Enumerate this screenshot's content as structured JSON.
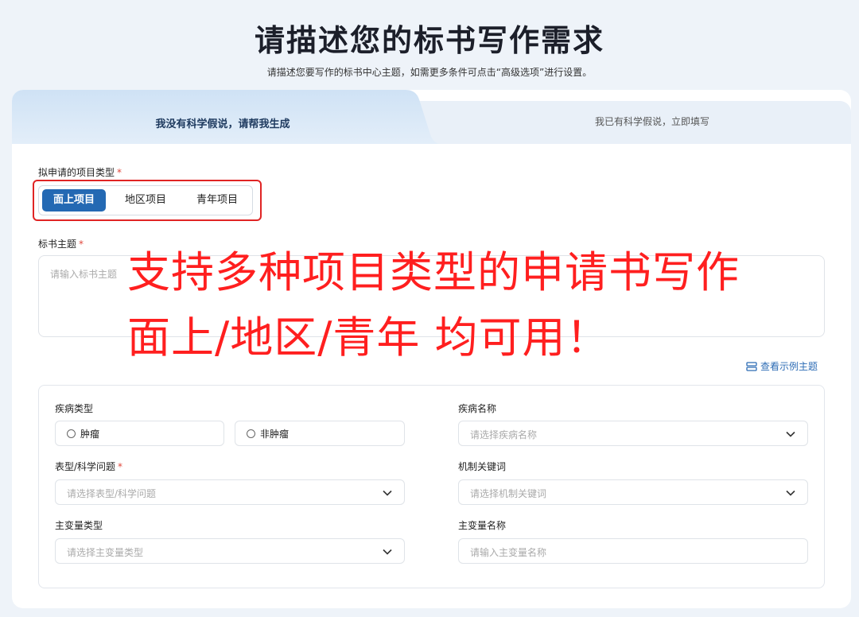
{
  "header": {
    "title": "请描述您的标书写作需求",
    "subtitle": "请描述您要写作的标书中心主题，如需更多条件可点击“高级选项”进行设置。"
  },
  "tabs": {
    "active": "我没有科学假说，请帮我生成",
    "inactive": "我已有科学假说，立即填写"
  },
  "project_type": {
    "label": "拟申请的项目类型",
    "required_mark": "*",
    "options": [
      "面上项目",
      "地区项目",
      "青年项目"
    ],
    "selected": "面上项目"
  },
  "topic": {
    "label": "标书主题",
    "required_mark": "*",
    "placeholder": "请输入标书主题"
  },
  "overlay": {
    "line1": "支持多种项目类型的申请书写作",
    "line2": "面上/地区/青年 均可用！"
  },
  "example_link": "查看示例主题",
  "form": {
    "disease_type": {
      "label": "疾病类型",
      "options": [
        "肿瘤",
        "非肿瘤"
      ]
    },
    "disease_name": {
      "label": "疾病名称",
      "placeholder": "请选择疾病名称"
    },
    "phenotype": {
      "label": "表型/科学问题",
      "required_mark": "*",
      "placeholder": "请选择表型/科学问题"
    },
    "mechanism": {
      "label": "机制关键词",
      "placeholder": "请选择机制关键词"
    },
    "main_var_type": {
      "label": "主变量类型",
      "placeholder": "请选择主变量类型"
    },
    "main_var_name": {
      "label": "主变量名称",
      "placeholder": "请输入主变量名称"
    }
  },
  "colors": {
    "accent": "#2469b3",
    "highlight": "#e02424",
    "overlay_text": "#ff1f1f"
  }
}
